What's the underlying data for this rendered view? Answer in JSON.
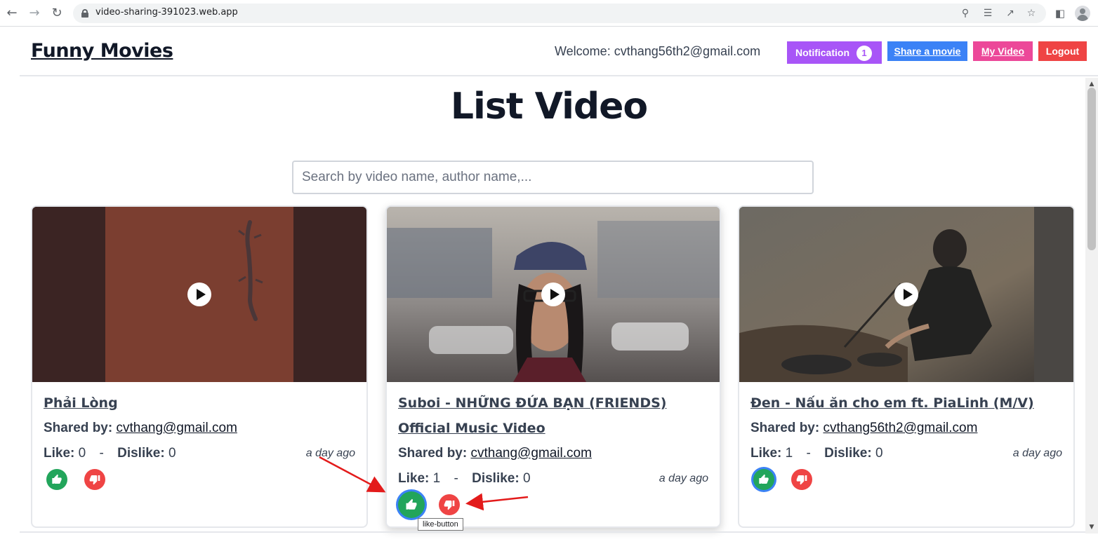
{
  "browser": {
    "url": "video-sharing-391023.web.app",
    "back_icon": "back-arrow-icon",
    "forward_icon": "forward-arrow-icon",
    "reload_icon": "reload-icon"
  },
  "header": {
    "brand": "Funny Movies",
    "welcome": "Welcome: cvthang56th2@gmail.com",
    "notification_label": "Notification",
    "notification_count": "1",
    "share_label": "Share a movie",
    "my_video_label": "My Video",
    "logout_label": "Logout"
  },
  "main": {
    "title": "List Video",
    "search_placeholder": "Search by video name, author name,..."
  },
  "labels": {
    "shared_by": "Shared by:",
    "like": "Like:",
    "dislike": "Dislike:",
    "separator": "-"
  },
  "videos": [
    {
      "title": "Phải Lòng",
      "author": "cvthang@gmail.com",
      "likes": "0",
      "dislikes": "0",
      "ago": "a day ago",
      "liked": false
    },
    {
      "title": "Suboi - NHỮNG ĐỨA BẠN (FRIENDS) Official Music Video",
      "author": "cvthang@gmail.com",
      "likes": "1",
      "dislikes": "0",
      "ago": "a day ago",
      "liked": true
    },
    {
      "title": "Đen - Nấu ăn cho em ft. PiaLinh (M/V)",
      "author": "cvthang56th2@gmail.com",
      "likes": "1",
      "dislikes": "0",
      "ago": "a day ago",
      "liked": true
    }
  ],
  "tooltip": "like-button",
  "colors": {
    "notification": "#a855f7",
    "share": "#3b82f6",
    "my_video": "#ec4899",
    "logout": "#ef4444",
    "like": "#22a55b",
    "dislike": "#ef4444",
    "annotation_arrow": "#e31b1b"
  }
}
